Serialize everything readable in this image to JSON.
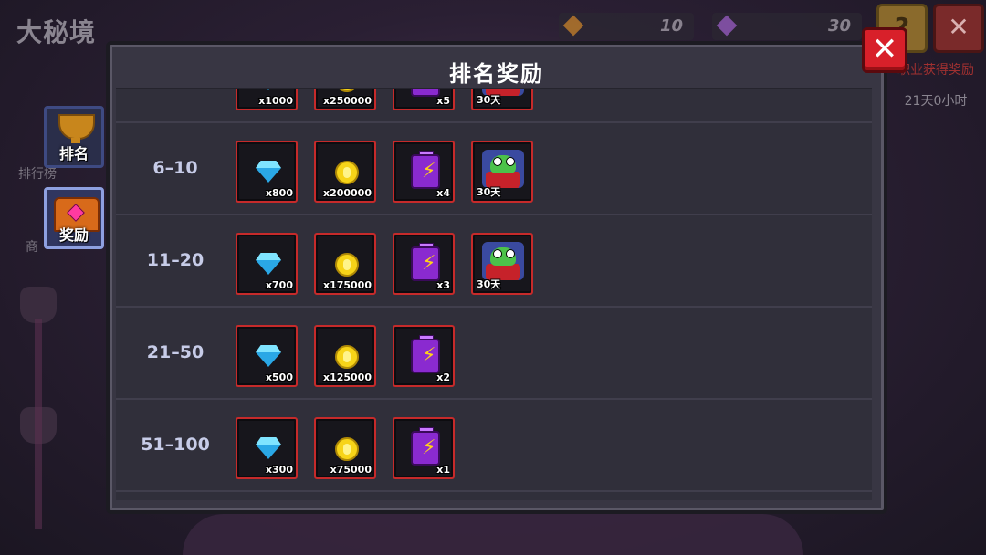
{
  "background": {
    "page_title": "大秘境",
    "resources": [
      {
        "value": "10",
        "color": "#c9842a"
      },
      {
        "value": "30",
        "color": "#9a5fc4"
      }
    ],
    "help_label": "?",
    "close_label": "✕",
    "side_text": "职业获得奖励",
    "side_time": "21天0小时",
    "side_labels": [
      "排行榜",
      "商"
    ]
  },
  "tabs": [
    {
      "label": "排名",
      "icon": "trophy-icon"
    },
    {
      "label": "奖励",
      "icon": "treasure-chest-icon"
    }
  ],
  "dialog": {
    "title": "排名奖励",
    "close_label": "✕"
  },
  "rows": [
    {
      "rank": "",
      "items": [
        {
          "icon": "gem-icon",
          "qty": "x1000"
        },
        {
          "icon": "gold-coin-icon",
          "qty": "x250000"
        },
        {
          "icon": "energy-battery-icon",
          "qty": "x5"
        },
        {
          "icon": "frog-skin-icon",
          "qty": "30天"
        }
      ]
    },
    {
      "rank": "6–10",
      "items": [
        {
          "icon": "gem-icon",
          "qty": "x800"
        },
        {
          "icon": "gold-coin-icon",
          "qty": "x200000"
        },
        {
          "icon": "energy-battery-icon",
          "qty": "x4"
        },
        {
          "icon": "frog-skin-icon",
          "qty": "30天"
        }
      ]
    },
    {
      "rank": "11–20",
      "items": [
        {
          "icon": "gem-icon",
          "qty": "x700"
        },
        {
          "icon": "gold-coin-icon",
          "qty": "x175000"
        },
        {
          "icon": "energy-battery-icon",
          "qty": "x3"
        },
        {
          "icon": "frog-skin-icon",
          "qty": "30天"
        }
      ]
    },
    {
      "rank": "21–50",
      "items": [
        {
          "icon": "gem-icon",
          "qty": "x500"
        },
        {
          "icon": "gold-coin-icon",
          "qty": "x125000"
        },
        {
          "icon": "energy-battery-icon",
          "qty": "x2"
        }
      ]
    },
    {
      "rank": "51–100",
      "items": [
        {
          "icon": "gem-icon",
          "qty": "x300"
        },
        {
          "icon": "gold-coin-icon",
          "qty": "x75000"
        },
        {
          "icon": "energy-battery-icon",
          "qty": "x1"
        }
      ]
    }
  ]
}
